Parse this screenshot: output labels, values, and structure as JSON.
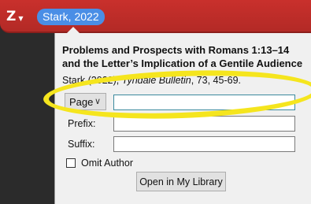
{
  "toolbar": {
    "logo_letter": "Z",
    "logo_icon": "zotero-logo-icon",
    "dropdown_icon": "caret-down-icon",
    "citation_bubble": "Stark, 2022"
  },
  "colors": {
    "bar_red": "#c9302c",
    "bubble_blue": "#4a8ee6",
    "highlight_yellow": "#f5e51e"
  },
  "panel": {
    "title": "Problems and Prospects with Romans 1:13–14 and the Letter’s Implication of a Gentile Audience",
    "citation": {
      "prefix": "Stark (2022), ",
      "journal": "Tyndale Bulletin",
      "suffix": ", 73, 45-69."
    },
    "locator": {
      "selected": "Page",
      "value": ""
    },
    "prefix_label": "Prefix:",
    "prefix_value": "",
    "suffix_label": "Suffix:",
    "suffix_value": "",
    "omit_author_label": "Omit Author",
    "omit_author_checked": false,
    "open_library_label": "Open in My Library"
  }
}
